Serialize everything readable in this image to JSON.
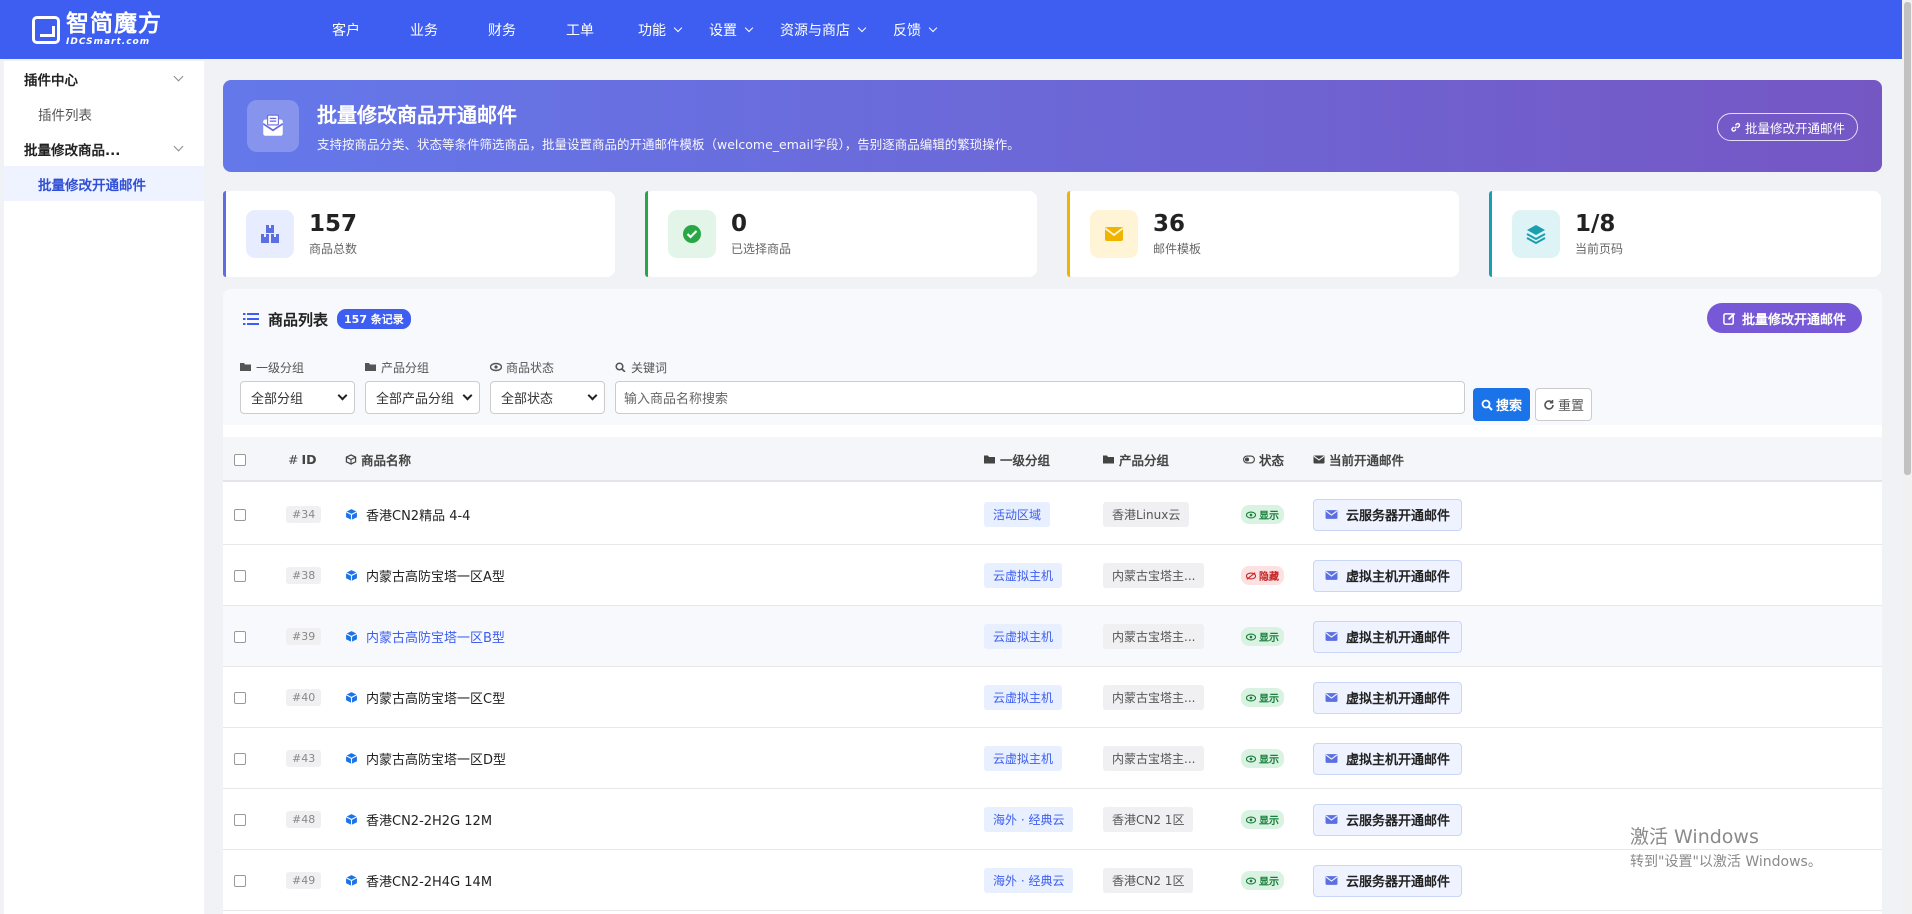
{
  "nav": {
    "logo_cn": "智简魔方",
    "logo_en": "IDCSmart.com",
    "items": [
      {
        "label": "客户",
        "dropdown": false
      },
      {
        "label": "业务",
        "dropdown": false
      },
      {
        "label": "财务",
        "dropdown": false
      },
      {
        "label": "工单",
        "dropdown": false
      },
      {
        "label": "功能",
        "dropdown": true
      },
      {
        "label": "设置",
        "dropdown": true
      },
      {
        "label": "资源与商店",
        "dropdown": true
      },
      {
        "label": "反馈",
        "dropdown": true
      }
    ]
  },
  "sidebar": {
    "group1": "插件中心",
    "item1": "插件列表",
    "group2": "批量修改商品...",
    "item2": "批量修改开通邮件"
  },
  "banner": {
    "title": "批量修改商品开通邮件",
    "desc": "支持按商品分类、状态等条件筛选商品，批量设置商品的开通邮件模板（welcome_email字段），告别逐商品编辑的繁琐操作。",
    "button": "批量修改开通邮件"
  },
  "stats": [
    {
      "value": "157",
      "label": "商品总数",
      "color": "#5b6fe0",
      "icon": "boxes-icon"
    },
    {
      "value": "0",
      "label": "已选择商品",
      "color": "#28a745",
      "icon": "check-circle-icon"
    },
    {
      "value": "36",
      "label": "邮件模板",
      "color": "#f0b400",
      "icon": "envelope-icon"
    },
    {
      "value": "1/8",
      "label": "当前页码",
      "color": "#1a9fb0",
      "icon": "layers-icon"
    }
  ],
  "list": {
    "title": "商品列表",
    "count": "157 条记录",
    "batch_button": "批量修改开通邮件"
  },
  "filters": {
    "group1_label": "一级分组",
    "group1_value": "全部分组",
    "group2_label": "产品分组",
    "group2_value": "全部产品分组",
    "status_label": "商品状态",
    "status_value": "全部状态",
    "keyword_label": "关键词",
    "keyword_placeholder": "输入商品名称搜索",
    "search": "搜索",
    "reset": "重置"
  },
  "table": {
    "headers": {
      "id": "ID",
      "name": "商品名称",
      "group1": "一级分组",
      "group2": "产品分组",
      "status": "状态",
      "mail": "当前开通邮件"
    },
    "rows": [
      {
        "id": "#34",
        "name": "香港CN2精品 4-4",
        "group1": "活动区域",
        "group2": "香港Linux云",
        "status": "显示",
        "mail": "云服务器开通邮件"
      },
      {
        "id": "#38",
        "name": "内蒙古高防宝塔一区A型",
        "group1": "云虚拟主机",
        "group2": "内蒙古宝塔主...",
        "status": "隐藏",
        "mail": "虚拟主机开通邮件"
      },
      {
        "id": "#39",
        "name": "内蒙古高防宝塔一区B型",
        "group1": "云虚拟主机",
        "group2": "内蒙古宝塔主...",
        "status": "显示",
        "mail": "虚拟主机开通邮件"
      },
      {
        "id": "#40",
        "name": "内蒙古高防宝塔一区C型",
        "group1": "云虚拟主机",
        "group2": "内蒙古宝塔主...",
        "status": "显示",
        "mail": "虚拟主机开通邮件"
      },
      {
        "id": "#43",
        "name": "内蒙古高防宝塔一区D型",
        "group1": "云虚拟主机",
        "group2": "内蒙古宝塔主...",
        "status": "显示",
        "mail": "虚拟主机开通邮件"
      },
      {
        "id": "#48",
        "name": "香港CN2-2H2G 12M",
        "group1": "海外 · 经典云",
        "group2": "香港CN2 1区",
        "status": "显示",
        "mail": "云服务器开通邮件"
      },
      {
        "id": "#49",
        "name": "香港CN2-2H4G 14M",
        "group1": "海外 · 经典云",
        "group2": "香港CN2 1区",
        "status": "显示",
        "mail": "云服务器开通邮件"
      }
    ]
  },
  "watermark": {
    "line1": "激活 Windows",
    "line2": "转到\"设置\"以激活 Windows。"
  }
}
